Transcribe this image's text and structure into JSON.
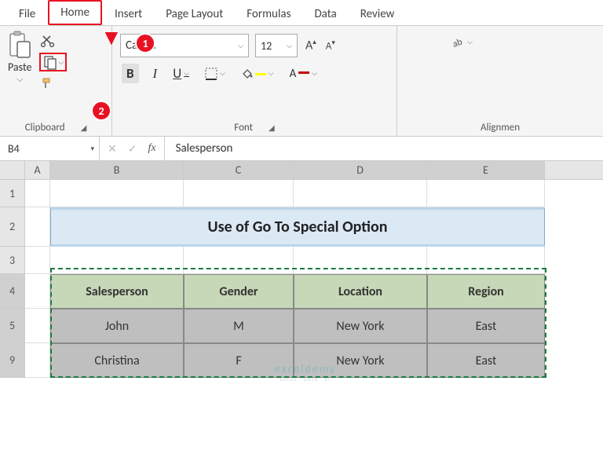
{
  "tabs": {
    "file": "File",
    "home": "Home",
    "insert": "Insert",
    "page_layout": "Page Layout",
    "formulas": "Formulas",
    "data": "Data",
    "review": "Review"
  },
  "callouts": {
    "one": "1",
    "two": "2"
  },
  "ribbon": {
    "clipboard": {
      "label": "Clipboard",
      "paste": "Paste",
      "paste_caret": "⌵"
    },
    "font": {
      "label": "Font",
      "name": "Calibri",
      "size": "12",
      "bold": "B",
      "italic": "I",
      "underline": "U",
      "grow": "A",
      "shrink": "A",
      "font_letter": "A"
    },
    "alignment": {
      "label": "Alignmen"
    }
  },
  "namebox": "B4",
  "formula_value": "Salesperson",
  "columns": {
    "a": "A",
    "b": "B",
    "c": "C",
    "d": "D",
    "e": "E"
  },
  "rows": {
    "r1": "1",
    "r2": "2",
    "r3": "3",
    "r4": "4",
    "r5": "5",
    "r9": "9"
  },
  "sheet": {
    "title": "Use of Go To Special Option",
    "headers": {
      "salesperson": "Salesperson",
      "gender": "Gender",
      "location": "Location",
      "region": "Region"
    },
    "data": [
      {
        "salesperson": "John",
        "gender": "M",
        "location": "New York",
        "region": "East"
      },
      {
        "salesperson": "Christina",
        "gender": "F",
        "location": "New York",
        "region": "East"
      }
    ]
  },
  "watermark": {
    "main": "exceldemy",
    "sub": "EXCEL · DATA · BI"
  }
}
